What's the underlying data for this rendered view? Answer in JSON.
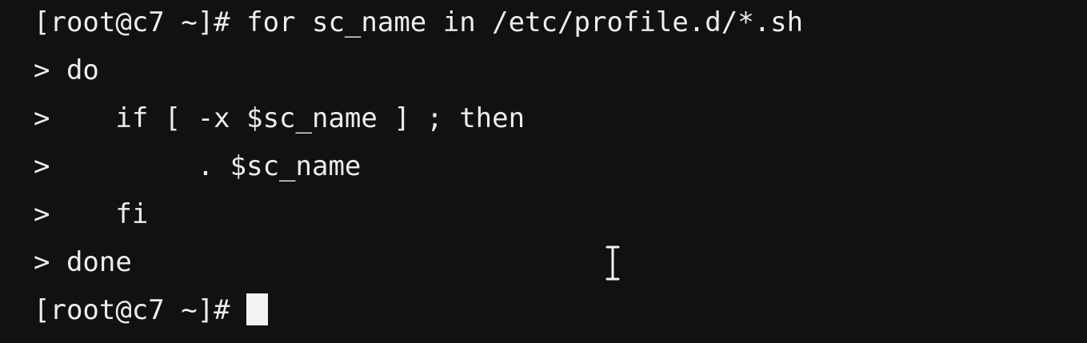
{
  "terminal": {
    "lines": [
      "[root@c7 ~]# for sc_name in /etc/profile.d/*.sh",
      "> do",
      ">    if [ -x $sc_name ] ; then",
      ">         . $sc_name",
      ">    fi",
      "> done"
    ],
    "prompt": "[root@c7 ~]# "
  },
  "icons": {
    "cursor": "block-cursor",
    "pointer": "text-ibeam-cursor-icon"
  }
}
